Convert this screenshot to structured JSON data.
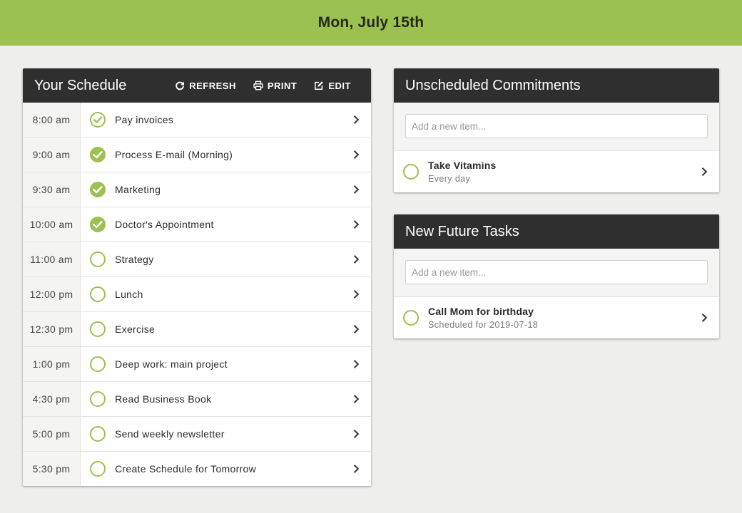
{
  "header": {
    "date": "Mon, July 15th",
    "bg_color": "#9bc150"
  },
  "accent_color": "#9bc150",
  "schedule": {
    "title": "Your Schedule",
    "actions": [
      {
        "label": "REFRESH",
        "icon": "refresh-icon"
      },
      {
        "label": "PRINT",
        "icon": "print-icon"
      },
      {
        "label": "EDIT",
        "icon": "edit-icon"
      }
    ],
    "rows": [
      {
        "time": "8:00 am",
        "task": "Pay invoices",
        "status": "done-outline"
      },
      {
        "time": "9:00 am",
        "task": "Process E-mail (Morning)",
        "status": "done"
      },
      {
        "time": "9:30 am",
        "task": "Marketing",
        "status": "done"
      },
      {
        "time": "10:00 am",
        "task": "Doctor's Appointment",
        "status": "done"
      },
      {
        "time": "11:00 am",
        "task": "Strategy",
        "status": "todo"
      },
      {
        "time": "12:00 pm",
        "task": "Lunch",
        "status": "todo"
      },
      {
        "time": "12:30 pm",
        "task": "Exercise",
        "status": "todo"
      },
      {
        "time": "1:00 pm",
        "task": "Deep work: main project",
        "status": "todo"
      },
      {
        "time": "4:30 pm",
        "task": "Read Business Book",
        "status": "todo"
      },
      {
        "time": "5:00 pm",
        "task": "Send weekly newsletter",
        "status": "todo"
      },
      {
        "time": "5:30 pm",
        "task": "Create Schedule for Tomorrow",
        "status": "todo"
      }
    ]
  },
  "unscheduled": {
    "title": "Unscheduled Commitments",
    "placeholder": "Add a new item...",
    "items": [
      {
        "title": "Take Vitamins",
        "subtitle": "Every day",
        "status": "todo"
      }
    ]
  },
  "future": {
    "title": "New Future Tasks",
    "placeholder": "Add a new item...",
    "items": [
      {
        "title": "Call Mom for birthday",
        "subtitle": "Scheduled for 2019-07-18",
        "status": "todo"
      }
    ]
  }
}
